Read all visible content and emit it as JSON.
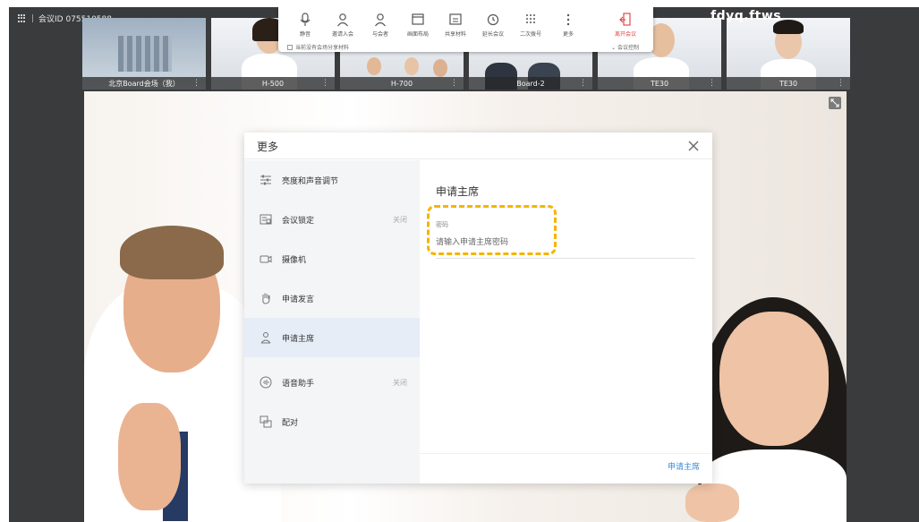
{
  "meeting": {
    "id_label": "会议ID 075510588"
  },
  "brand": {
    "name": "fdyq.ftws"
  },
  "toolbar": {
    "items": [
      {
        "label": "静音",
        "icon": "microphone-icon"
      },
      {
        "label": "邀请入会",
        "icon": "add-person-icon"
      },
      {
        "label": "与会者",
        "icon": "participants-icon"
      },
      {
        "label": "画面布局",
        "icon": "layout-icon"
      },
      {
        "label": "共享材料",
        "icon": "share-icon"
      },
      {
        "label": "延长会议",
        "icon": "clock-icon"
      },
      {
        "label": "二次拨号",
        "icon": "dialpad-icon"
      },
      {
        "label": "更多",
        "icon": "more-icon"
      },
      {
        "label": "离开会议",
        "icon": "leave-icon"
      }
    ],
    "sub_left": "当前没有会场分享材料",
    "sub_right": "会议控制"
  },
  "thumbnails": [
    {
      "label": "北京Board会场（我）"
    },
    {
      "label": "H-500"
    },
    {
      "label": "H-700"
    },
    {
      "label": "Board-2"
    },
    {
      "label": "TE30"
    },
    {
      "label": "TE30"
    }
  ],
  "dialog": {
    "title": "更多",
    "menu": [
      {
        "label": "亮度和声音调节",
        "value": "",
        "icon": "sliders-icon"
      },
      {
        "label": "会议锁定",
        "value": "关闭",
        "icon": "lock-icon"
      },
      {
        "label": "摄像机",
        "value": "",
        "icon": "camera-icon"
      },
      {
        "label": "申请发言",
        "value": "",
        "icon": "hand-icon"
      },
      {
        "label": "申请主席",
        "value": "",
        "icon": "chair-person-icon"
      },
      {
        "label": "语音助手",
        "value": "关闭",
        "icon": "voice-assistant-icon"
      },
      {
        "label": "配对",
        "value": "",
        "icon": "pair-icon"
      }
    ],
    "panel": {
      "title": "申请主席",
      "password_label": "密码",
      "password_placeholder": "请输入申请主席密码",
      "password_value": "",
      "apply_button": "申请主席"
    }
  },
  "colors": {
    "accent": "#3a8ad8",
    "highlight": "#f5b400",
    "leave": "#e24b4b",
    "active_bg": "#e6edf6"
  }
}
